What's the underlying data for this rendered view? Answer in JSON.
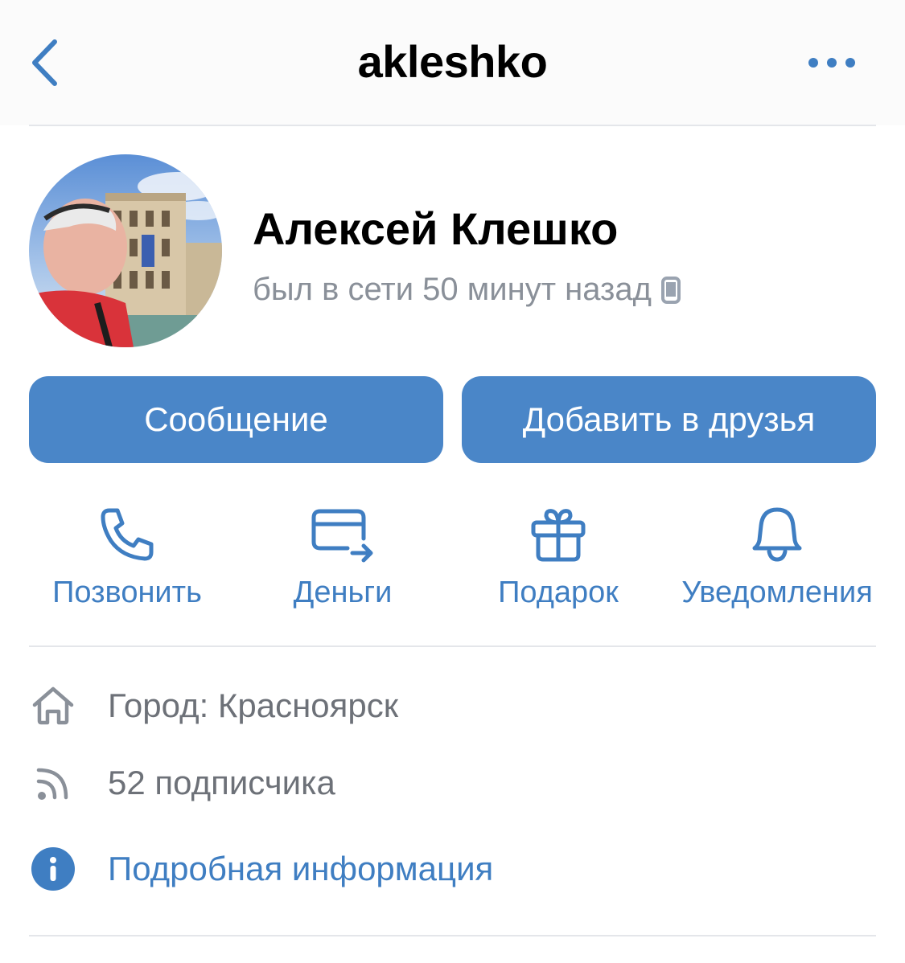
{
  "header": {
    "title": "akleshko",
    "back_icon": "chevron-left-icon",
    "more_icon": "more-horizontal-icon"
  },
  "profile": {
    "name": "Алексей Клешко",
    "status": "был в сети 50 минут назад",
    "status_icon": "mobile-phone-icon"
  },
  "buttons": {
    "message": "Сообщение",
    "add_friend": "Добавить в друзья"
  },
  "actions": [
    {
      "label": "Позвонить",
      "icon": "phone-icon"
    },
    {
      "label": "Деньги",
      "icon": "money-transfer-icon"
    },
    {
      "label": "Подарок",
      "icon": "gift-icon"
    },
    {
      "label": "Уведомления",
      "icon": "bell-icon"
    }
  ],
  "info": {
    "city": "Город: Красноярск",
    "followers": "52 подписчика",
    "details": "Подробная информация"
  },
  "colors": {
    "accent": "#4a86c8",
    "link": "#3f7ec2",
    "secondary_text": "#8a9099",
    "divider": "#e4e6ea"
  }
}
